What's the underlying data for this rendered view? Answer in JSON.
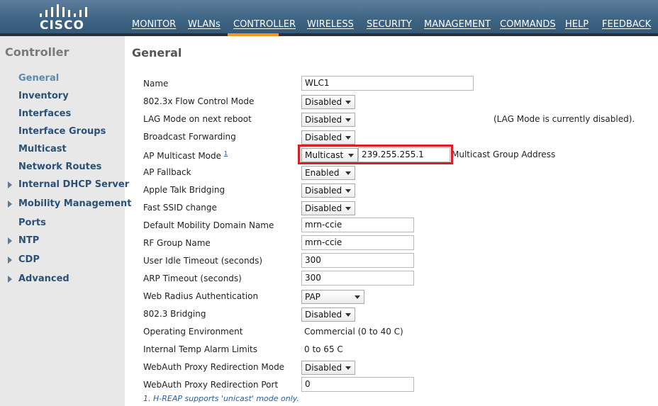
{
  "brand": {
    "logo_text": "CISCO"
  },
  "nav": {
    "items": [
      "MONITOR",
      "WLANs",
      "CONTROLLER",
      "WIRELESS",
      "SECURITY",
      "MANAGEMENT",
      "COMMANDS",
      "HELP",
      "FEEDBACK"
    ],
    "active": "CONTROLLER",
    "active_color": "#f7941d"
  },
  "sidebar": {
    "title": "Controller",
    "items": [
      {
        "label": "General",
        "active": true,
        "expandable": false
      },
      {
        "label": "Inventory",
        "expandable": false
      },
      {
        "label": "Interfaces",
        "expandable": false
      },
      {
        "label": "Interface Groups",
        "expandable": false
      },
      {
        "label": "Multicast",
        "expandable": false
      },
      {
        "label": "Network Routes",
        "expandable": false
      },
      {
        "label": "Internal DHCP Server",
        "expandable": true
      },
      {
        "label": "Mobility Management",
        "expandable": true
      },
      {
        "label": "Ports",
        "expandable": false
      },
      {
        "label": "NTP",
        "expandable": true
      },
      {
        "label": "CDP",
        "expandable": true
      },
      {
        "label": "Advanced",
        "expandable": true
      }
    ]
  },
  "page": {
    "title": "General",
    "fields": {
      "name": {
        "label": "Name",
        "value": "WLC1"
      },
      "flow_control": {
        "label": "802.3x Flow Control Mode",
        "value": "Disabled"
      },
      "lag_mode": {
        "label": "LAG Mode on next reboot",
        "value": "Disabled",
        "note": "(LAG Mode is currently disabled)."
      },
      "broadcast_forwarding": {
        "label": "Broadcast Forwarding",
        "value": "Disabled"
      },
      "ap_multicast_mode": {
        "label": "AP Multicast Mode",
        "footnote_ref": "1",
        "value": "Multicast",
        "group_address": "239.255.255.1",
        "group_address_label": "Multicast Group Address"
      },
      "ap_fallback": {
        "label": "AP Fallback",
        "value": "Enabled"
      },
      "apple_talk": {
        "label": "Apple Talk Bridging",
        "value": "Disabled"
      },
      "fast_ssid": {
        "label": "Fast SSID change",
        "value": "Disabled"
      },
      "mobility_domain": {
        "label": "Default Mobility Domain Name",
        "value": "mrn-ccie"
      },
      "rf_group": {
        "label": "RF Group Name",
        "value": "mrn-ccie"
      },
      "user_idle_timeout": {
        "label": "User Idle Timeout (seconds)",
        "value": "300"
      },
      "arp_timeout": {
        "label": "ARP Timeout (seconds)",
        "value": "300"
      },
      "web_radius_auth": {
        "label": "Web Radius Authentication",
        "value": "PAP"
      },
      "bridging_8023": {
        "label": "802.3 Bridging",
        "value": "Disabled"
      },
      "operating_env": {
        "label": "Operating Environment",
        "value": "Commercial (0 to 40 C)"
      },
      "temp_alarm": {
        "label": "Internal Temp Alarm Limits",
        "value": "0 to 65 C"
      },
      "webauth_mode": {
        "label": "WebAuth Proxy Redirection Mode",
        "value": "Disabled"
      },
      "webauth_port": {
        "label": "WebAuth Proxy Redirection Port",
        "value": "0"
      }
    },
    "footnote": "1. H-REAP supports 'unicast' mode only.",
    "highlight_color": "#d81e27"
  }
}
